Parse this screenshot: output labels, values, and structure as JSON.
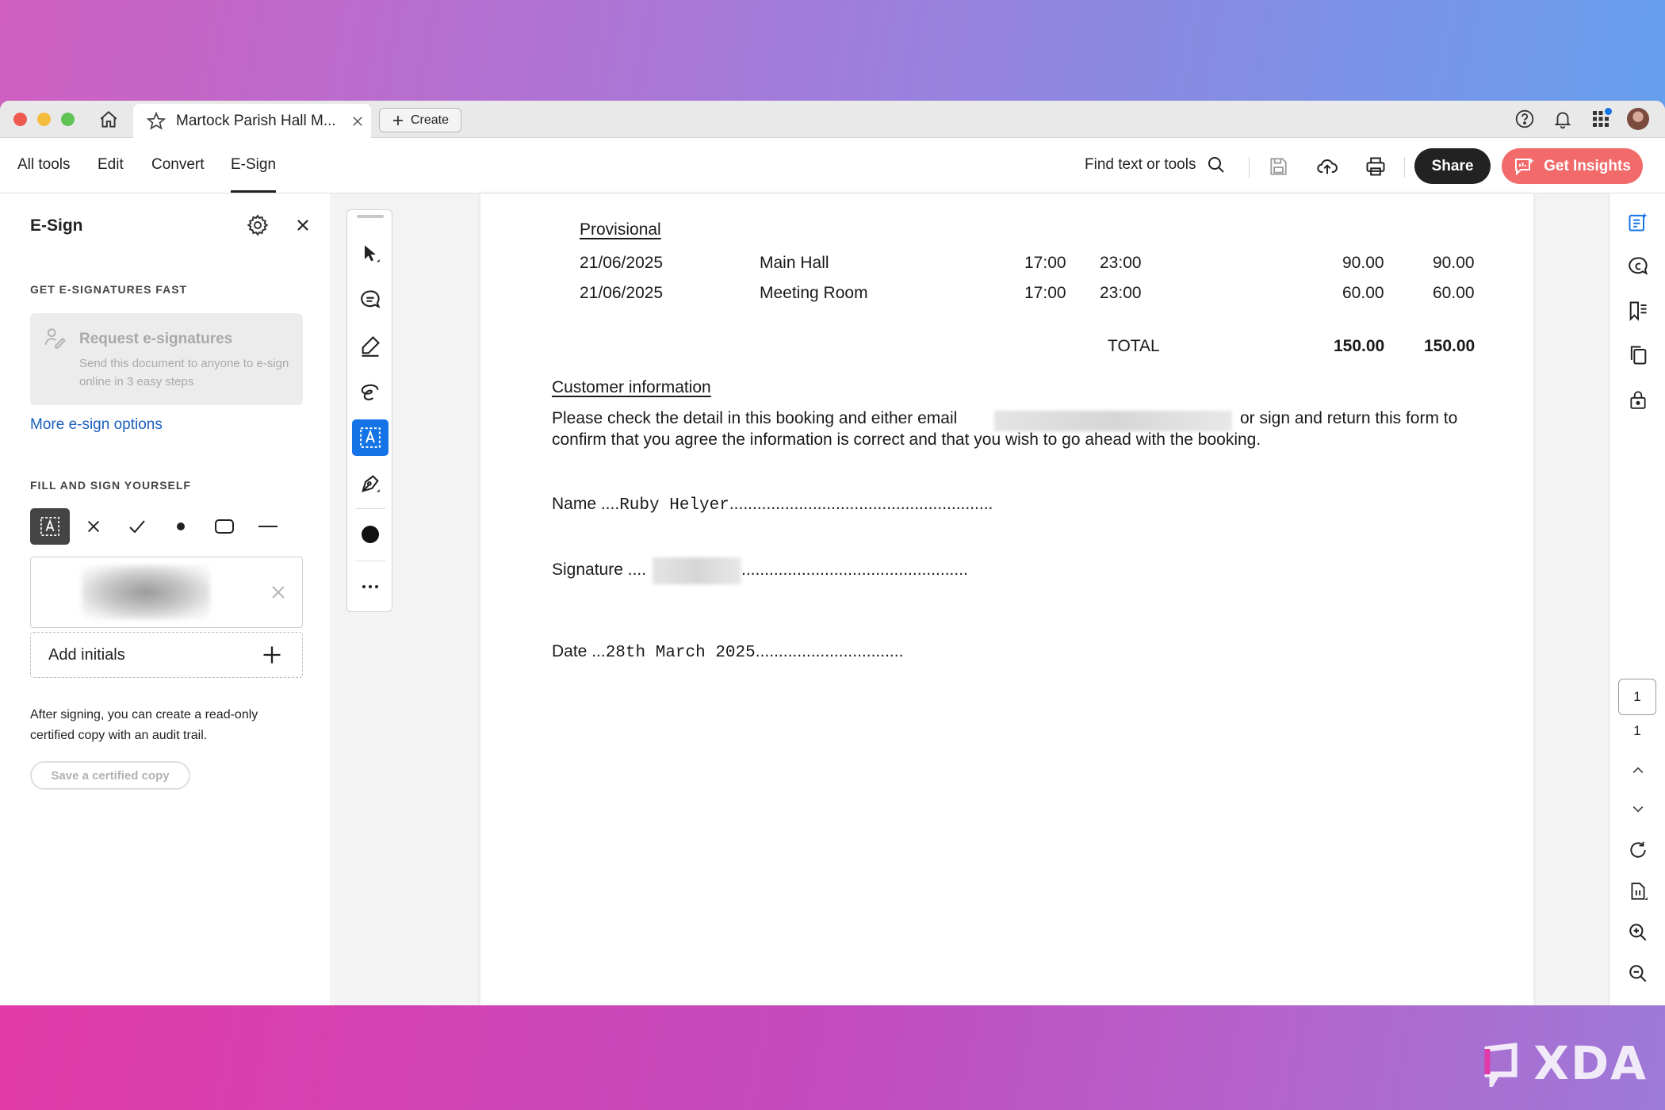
{
  "tab": {
    "title": "Martock Parish Hall M...",
    "create_label": "Create"
  },
  "menu": {
    "items": [
      "All tools",
      "Edit",
      "Convert",
      "E-Sign"
    ],
    "active": "E-Sign",
    "find_label": "Find text or tools",
    "share_label": "Share",
    "insights_label": "Get Insights"
  },
  "esign_panel": {
    "title": "E-Sign",
    "section_fast": "GET E-SIGNATURES FAST",
    "request_title": "Request e-signatures",
    "request_desc": "Send this document to anyone to e-sign online in 3 easy steps",
    "more_link": "More e-sign options",
    "section_fill": "FILL AND SIGN YOURSELF",
    "add_initials": "Add initials",
    "after_text": "After signing, you can create a read-only certified copy with an audit trail.",
    "certified_btn": "Save a certified copy"
  },
  "document": {
    "provisional_heading": "Provisional",
    "bookings": [
      {
        "date": "21/06/2025",
        "room": "Main Hall",
        "start": "17:00",
        "end": "23:00",
        "amount": "90.00",
        "total": "90.00"
      },
      {
        "date": "21/06/2025",
        "room": "Meeting Room",
        "start": "17:00",
        "end": "23:00",
        "amount": "60.00",
        "total": "60.00"
      }
    ],
    "total_label": "TOTAL",
    "total_amount": "150.00",
    "total_total": "150.00",
    "customer_heading": "Customer information",
    "para_line1_a": "Please check the detail in this booking and either email",
    "para_line1_b": "or sign and return this form to",
    "para_line2": "confirm that you agree the information is correct and that you wish to go ahead with the booking.",
    "name_label": "Name ....",
    "name_value": "Ruby Helyer",
    "name_dots": ".........................................................",
    "signature_label": "Signature ....",
    "signature_dots": ".................................................",
    "date_label": "Date ...",
    "date_value": "28th March 2025",
    "date_dots": "................................"
  },
  "pagination": {
    "current": "1",
    "total": "1"
  },
  "watermark": "XDA",
  "colors": {
    "accent_blue": "#1473e6",
    "insights_red": "#f26a6a",
    "link_blue": "#1b5fbd"
  }
}
